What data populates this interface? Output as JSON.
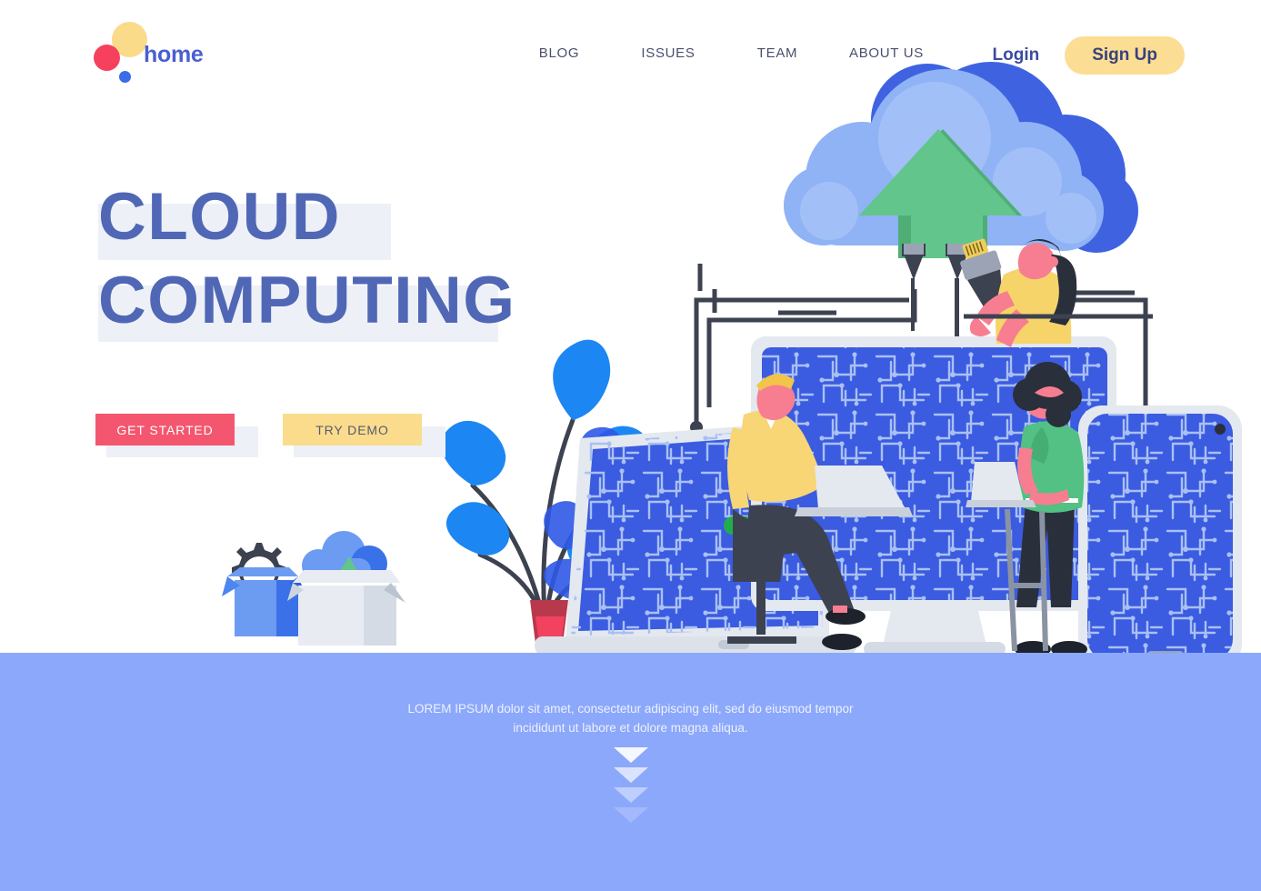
{
  "brand": {
    "name": "home",
    "logo_icon": "three-dots-logo-icon",
    "colors": {
      "yellow": "#F9DB8A",
      "red": "#F7405E",
      "blue": "#3A6CE8",
      "text": "#4960D0"
    }
  },
  "nav": {
    "items": [
      {
        "id": "blog",
        "label": "BLOG"
      },
      {
        "id": "issues",
        "label": "ISSUES"
      },
      {
        "id": "team",
        "label": "TEAM"
      },
      {
        "id": "about",
        "label": "ABOUT US"
      }
    ],
    "login_label": "Login",
    "signup_label": "Sign Up",
    "signup_bg": "#FBDE93"
  },
  "hero": {
    "headline_line1": "CLOUD",
    "headline_line2": "COMPUTING",
    "headline_color": "#5067B6",
    "highlight_color": "#EDF0F6",
    "cta_primary": {
      "label": "GET STARTED",
      "bg": "#F4566F",
      "color": "#FFFFFF"
    },
    "cta_secondary": {
      "label": "TRY DEMO",
      "bg": "#FBDC8D",
      "color": "#555A6E"
    }
  },
  "illustration": {
    "alt": "cloud computing flat illustration",
    "elements": [
      "cloud-upload-icon",
      "desktop-monitor-circuit-screen",
      "laptop-circuit-screen",
      "smartphone-circuit-screen",
      "man-with-laptop-on-stool",
      "woman-with-laptop-standing",
      "woman-holding-ethernet-cable",
      "potted-plant",
      "cardboard-box-with-gear",
      "cardboard-box-with-cloud"
    ],
    "colors": {
      "cloud_light": "#8FB3F5",
      "cloud_dark": "#3F63E0",
      "screen_blue": "#3B5BE0",
      "circuit_trace": "#A9C0F4",
      "device_frame": "#E4E8EF",
      "arrow_green": "#5FC186",
      "cable_dark": "#3D4250",
      "skin": "#F77E90",
      "sweater_yellow": "#F8D575",
      "vest_green": "#52C183",
      "pants_dark": "#3D4250",
      "stool_green": "#24AD4E",
      "plant_leaf": "#1C87F2",
      "plant_pot": "#F2425F"
    }
  },
  "bottom_band": {
    "bg": "#8CA8FB",
    "text": "LOREM IPSUM dolor sit amet, consectetur adipiscing elit, sed do eiusmod tempor incididunt ut labore et dolore magna aliqua.",
    "scroll_indicator": "chevron-down-arrows",
    "arrow_count": 4
  }
}
